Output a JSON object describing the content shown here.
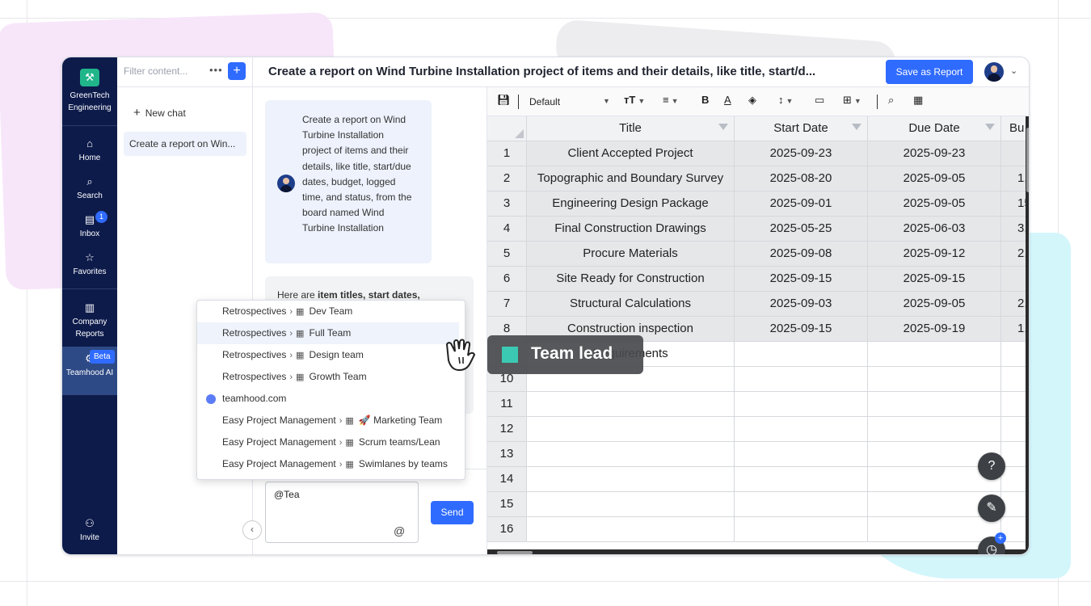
{
  "colors": {
    "accent": "#2f6bff",
    "nav_bg": "#0d1b4b",
    "tooltip_swatch": "#3cc9b4"
  },
  "nav": {
    "brand": "GreenTech Engineering",
    "items": [
      {
        "label": "Home",
        "icon": "home-icon"
      },
      {
        "label": "Search",
        "icon": "search-icon"
      },
      {
        "label": "Inbox",
        "icon": "inbox-icon",
        "badge": "1"
      },
      {
        "label": "Favorites",
        "icon": "star-icon"
      },
      {
        "label": "Company Reports",
        "icon": "chart-icon"
      },
      {
        "label": "Teamhood AI",
        "icon": "ai-icon",
        "badge": "Beta"
      },
      {
        "label": "Invite",
        "icon": "add-user-icon"
      }
    ]
  },
  "chat_sidebar": {
    "filter_placeholder": "Filter content...",
    "new_chat": "New chat",
    "items": [
      "Create a report on Win..."
    ]
  },
  "header": {
    "title": "Create a report on Wind Turbine Installation project of items and their details, like title, start/d...",
    "save_button": "Save as Report"
  },
  "chat": {
    "user_message": "Create a report on Wind Turbine Installation project of items and their details, like title, start/due dates, budget, logged time, and status, from the board named Wind Turbine Installation",
    "ai_message_prefix": "Here are ",
    "ai_message_bold": "item titles, start dates,",
    "input_value": "@Tea",
    "send_button": "Send"
  },
  "mention_dropdown": [
    {
      "parent": "Retrospectives",
      "name": "Dev Team",
      "type": "board"
    },
    {
      "parent": "Retrospectives",
      "name": "Full Team",
      "type": "board",
      "highlighted": true
    },
    {
      "parent": "Retrospectives",
      "name": "Design team",
      "type": "board"
    },
    {
      "parent": "Retrospectives",
      "name": "Growth Team",
      "type": "board"
    },
    {
      "parent": "",
      "name": "teamhood.com",
      "type": "workspace"
    },
    {
      "parent": "Easy Project Management",
      "name": "🚀 Marketing Team",
      "type": "board"
    },
    {
      "parent": "Easy Project Management",
      "name": "Scrum teams/Lean",
      "type": "board"
    },
    {
      "parent": "Easy Project Management",
      "name": "Swimlanes by teams",
      "type": "board"
    }
  ],
  "tooltip": {
    "label": "Team lead"
  },
  "toolbar": {
    "font": "Default"
  },
  "sheet": {
    "columns": [
      "Title",
      "Start Date",
      "Due Date",
      "Bu"
    ],
    "rows": [
      {
        "n": "1",
        "cells": [
          "Client Accepted Project",
          "2025-09-23",
          "2025-09-23",
          ""
        ]
      },
      {
        "n": "2",
        "cells": [
          "Topographic and Boundary Survey",
          "2025-08-20",
          "2025-09-05",
          "1,"
        ]
      },
      {
        "n": "3",
        "cells": [
          "Engineering Design Package",
          "2025-09-01",
          "2025-09-05",
          "15,"
        ]
      },
      {
        "n": "4",
        "cells": [
          "Final Construction Drawings",
          "2025-05-25",
          "2025-06-03",
          "3,"
        ]
      },
      {
        "n": "5",
        "cells": [
          "Procure Materials",
          "2025-09-08",
          "2025-09-12",
          "2,"
        ]
      },
      {
        "n": "6",
        "cells": [
          "Site Ready for Construction",
          "2025-09-15",
          "2025-09-15",
          ""
        ]
      },
      {
        "n": "7",
        "cells": [
          "Structural Calculations",
          "2025-09-03",
          "2025-09-05",
          "2,"
        ]
      },
      {
        "n": "8",
        "cells": [
          "Construction inspection",
          "2025-09-15",
          "2025-09-19",
          "1,"
        ]
      },
      {
        "n": "9",
        "cells": [
          "Requirements",
          "",
          "",
          ""
        ]
      },
      {
        "n": "10",
        "cells": [
          "",
          "",
          "",
          ""
        ]
      },
      {
        "n": "11",
        "cells": [
          "",
          "",
          "",
          ""
        ]
      },
      {
        "n": "12",
        "cells": [
          "",
          "",
          "",
          ""
        ]
      },
      {
        "n": "13",
        "cells": [
          "",
          "",
          "",
          ""
        ]
      },
      {
        "n": "14",
        "cells": [
          "",
          "",
          "",
          ""
        ]
      },
      {
        "n": "15",
        "cells": [
          "",
          "",
          "",
          ""
        ]
      },
      {
        "n": "16",
        "cells": [
          "",
          "",
          "",
          ""
        ]
      }
    ]
  },
  "fabs": [
    "help-icon",
    "notes-icon",
    "timer-icon"
  ]
}
